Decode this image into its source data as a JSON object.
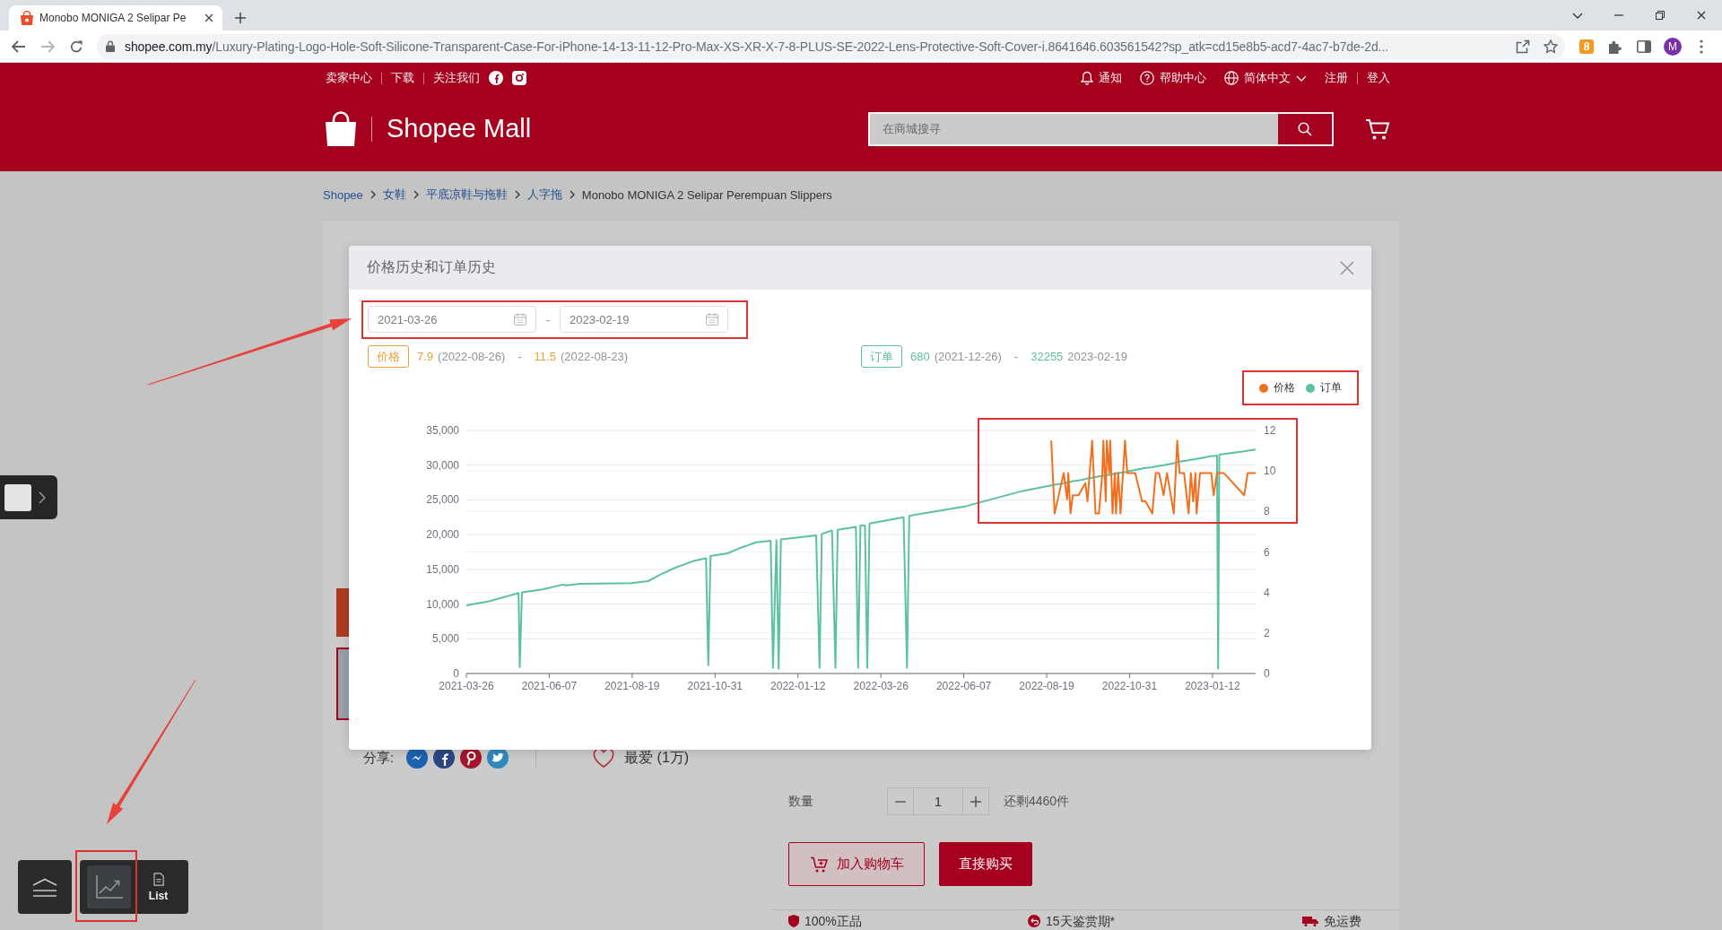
{
  "browser": {
    "tab": {
      "title": "Monobo MONIGA 2 Selipar Pe",
      "selected": true
    },
    "url": {
      "host": "shopee.com.my",
      "path": "/Luxury-Plating-Logo-Hole-Soft-Silicone-Transparent-Case-For-iPhone-14-13-11-12-Pro-Max-XS-XR-X-7-8-PLUS-SE-2022-Lens-Protective-Soft-Cover-i.8641646.603561542?sp_atk=cd15e8b5-acd7-4ac7-b7de-2d..."
    },
    "extension_badge": "8",
    "profile_initial": "M"
  },
  "header": {
    "top_left": [
      {
        "label": "卖家中心",
        "kind": "link"
      },
      {
        "label": "下载",
        "kind": "link"
      },
      {
        "label": "关注我们",
        "kind": "follow"
      }
    ],
    "top_right": [
      {
        "label": "通知",
        "kind": "notifications"
      },
      {
        "label": "帮助中心",
        "kind": "help"
      },
      {
        "label": "简体中文",
        "kind": "language"
      },
      {
        "label": "注册",
        "kind": "account"
      },
      {
        "label": "登入",
        "kind": "account"
      }
    ],
    "logo_text": "Shopee Mall",
    "search": {
      "placeholder": "在商城搜寻"
    }
  },
  "breadcrumb": [
    {
      "label": "Shopee",
      "kind": "link"
    },
    {
      "label": "女鞋",
      "kind": "link"
    },
    {
      "label": "平底凉鞋与拖鞋",
      "kind": "link"
    },
    {
      "label": "人字拖",
      "kind": "link"
    },
    {
      "label": "Monobo MONIGA 2 Selipar Perempuan Slippers",
      "kind": "current"
    }
  ],
  "product": {
    "share_label": "分享:",
    "favorite_label": "最爱 (1万)",
    "quantity": {
      "label": "数量",
      "value": "1",
      "stock": "还剩4460件"
    },
    "buttons": [
      {
        "label": "加入购物车",
        "kind": "add_to_cart"
      },
      {
        "label": "直接购买",
        "kind": "buy_now"
      }
    ],
    "guarantees": [
      {
        "label": "100%正品",
        "kind": "authentic"
      },
      {
        "label": "15天鉴赏期*",
        "kind": "returns"
      },
      {
        "label": "免运费",
        "kind": "shipping"
      }
    ]
  },
  "modal": {
    "title": "价格历史和订单历史",
    "date_range": {
      "start": "2021-03-26",
      "separator": "-",
      "end": "2023-02-19"
    },
    "summaries": [
      {
        "tag": "价格",
        "color": "#e6a23c",
        "min": "7.9",
        "min_date": "(2022-08-26)",
        "separator": "-",
        "max": "11.5",
        "max_date": "(2022-08-23)"
      },
      {
        "tag": "订单",
        "color": "#5dbfa3",
        "min": "680",
        "min_date": "(2021-12-26)",
        "separator": "-",
        "max": "32255",
        "max_date": "2023-02-19"
      }
    ],
    "chart_data": {
      "type": "line",
      "grid": true,
      "legend": true,
      "xlim": [
        "2021-03-26",
        "2023-02-19"
      ],
      "ylim": [
        0,
        35000
      ],
      "y2lim": [
        0,
        12
      ],
      "xticks": [
        "2021-03-26",
        "2021-06-07",
        "2021-08-19",
        "2021-10-31",
        "2022-01-12",
        "2022-03-26",
        "2022-06-07",
        "2022-08-19",
        "2022-10-31",
        "2023-01-12"
      ],
      "yticks": [
        {
          "value": 0,
          "label": "0"
        },
        {
          "value": 5000,
          "label": "5,000"
        },
        {
          "value": 10000,
          "label": "10,000"
        },
        {
          "value": 15000,
          "label": "15,000"
        },
        {
          "value": 20000,
          "label": "20,000"
        },
        {
          "value": 25000,
          "label": "25,000"
        },
        {
          "value": 30000,
          "label": "30,000"
        },
        {
          "value": 35000,
          "label": "35,000"
        }
      ],
      "y2ticks": [
        0,
        2,
        4,
        6,
        8,
        10,
        12
      ],
      "x": [
        "2021-03-26",
        "2021-04-15",
        "2021-05-09",
        "2021-05-11",
        "2021-05-12",
        "2021-05-14",
        "2021-06-01",
        "2021-06-19",
        "2021-06-22",
        "2021-07-04",
        "2021-08-18",
        "2021-09-02",
        "2021-09-12",
        "2021-09-27",
        "2021-10-12",
        "2021-10-23",
        "2021-10-25",
        "2021-10-27",
        "2021-11-11",
        "2021-11-21",
        "2021-12-06",
        "2021-12-19",
        "2021-12-21",
        "2021-12-24",
        "2021-12-26",
        "2021-12-28",
        "2022-01-28",
        "2022-01-31",
        "2022-02-02",
        "2022-02-11",
        "2022-02-14",
        "2022-02-16",
        "2022-03-04",
        "2022-03-06",
        "2022-03-08",
        "2022-03-12",
        "2022-03-14",
        "2022-03-16",
        "2022-04-15",
        "2022-04-18",
        "2022-04-20",
        "2022-06-09",
        "2022-07-29",
        "2022-08-23",
        "2022-08-26",
        "2022-09-03",
        "2022-09-06",
        "2022-09-07",
        "2022-09-09",
        "2022-09-11",
        "2022-09-16",
        "2022-09-22",
        "2022-09-24",
        "2022-09-28",
        "2022-10-01",
        "2022-10-04",
        "2022-10-07",
        "2022-10-08",
        "2022-10-10",
        "2022-10-11",
        "2022-10-13",
        "2022-10-14",
        "2022-10-16",
        "2022-10-18",
        "2022-10-19",
        "2022-10-21",
        "2022-10-23",
        "2022-10-27",
        "2022-10-29",
        "2022-11-05",
        "2022-11-11",
        "2022-11-14",
        "2022-11-20",
        "2022-11-23",
        "2022-11-26",
        "2022-11-30",
        "2022-12-03",
        "2022-12-09",
        "2022-12-12",
        "2022-12-14",
        "2022-12-18",
        "2022-12-22",
        "2022-12-24",
        "2022-12-26",
        "2022-12-28",
        "2022-12-29",
        "2023-01-01",
        "2023-01-11",
        "2023-01-13",
        "2023-01-16",
        "2023-01-17",
        "2023-01-18",
        "2023-01-22",
        "2023-02-09",
        "2023-02-12",
        "2023-02-19"
      ],
      "series": [
        {
          "name": "价格",
          "color": "#f07020",
          "axis": "y2",
          "values": [
            null,
            null,
            null,
            null,
            null,
            null,
            null,
            null,
            null,
            null,
            null,
            null,
            null,
            null,
            null,
            null,
            null,
            null,
            null,
            null,
            null,
            null,
            null,
            null,
            null,
            null,
            null,
            null,
            null,
            null,
            null,
            null,
            null,
            null,
            null,
            null,
            null,
            null,
            null,
            null,
            null,
            null,
            null,
            11.5,
            7.9,
            9.9,
            8.6,
            9.9,
            7.9,
            8.8,
            8.8,
            9.4,
            8.5,
            11.5,
            7.9,
            7.9,
            9.9,
            11.5,
            8.5,
            11.5,
            9.9,
            11.5,
            7.9,
            9.9,
            7.9,
            9.9,
            7.9,
            11.5,
            9.9,
            9.9,
            8.5,
            8.5,
            7.9,
            9.9,
            9.9,
            8.8,
            9.9,
            7.9,
            11.5,
            9.9,
            9.9,
            7.9,
            9.9,
            8.5,
            9.9,
            7.9,
            9.9,
            9.9,
            8.8,
            9.9,
            9.9,
            9.9,
            9.9,
            8.8,
            9.9,
            9.9
          ]
        },
        {
          "name": "订单",
          "color": "#5cc0a4",
          "values": [
            9800,
            10400,
            11500,
            11600,
            900,
            11700,
            12100,
            12800,
            12700,
            12900,
            13000,
            13300,
            14200,
            15300,
            16200,
            16600,
            1200,
            16900,
            17300,
            18000,
            18900,
            19100,
            800,
            19200,
            680,
            19300,
            19900,
            800,
            20100,
            20600,
            800,
            20700,
            21100,
            800,
            21300,
            21300,
            800,
            21600,
            22500,
            800,
            22700,
            24100,
            26300,
            27100,
            27200,
            27400,
            27500,
            27500,
            27600,
            27700,
            27800,
            28000,
            28100,
            28200,
            28300,
            28400,
            28400,
            28500,
            28500,
            28600,
            28600,
            28600,
            28700,
            28800,
            28800,
            28900,
            28900,
            29000,
            29100,
            29300,
            29500,
            29600,
            29700,
            29800,
            29900,
            30000,
            30100,
            30300,
            30400,
            30500,
            30600,
            30700,
            30800,
            30800,
            30900,
            30900,
            31000,
            31300,
            31300,
            31400,
            700,
            31500,
            31600,
            32000,
            32100,
            32255
          ]
        }
      ]
    }
  },
  "dock": {
    "buttons": [
      {
        "kind": "chart",
        "selected": true
      },
      {
        "kind": "list",
        "label": "List",
        "selected": false
      }
    ]
  }
}
